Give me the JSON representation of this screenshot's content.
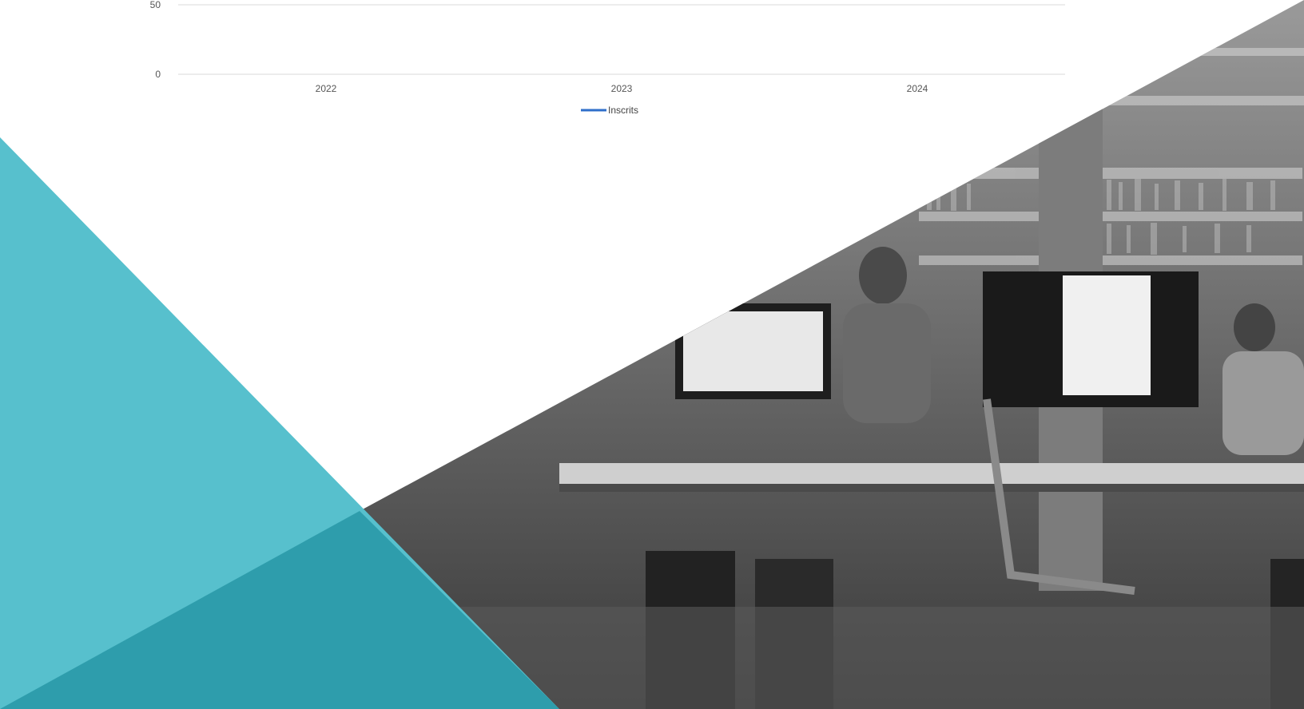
{
  "chart_data": {
    "type": "line",
    "categories": [
      "2022",
      "2023",
      "2024"
    ],
    "y_ticks": [
      0,
      50
    ],
    "series": [
      {
        "name": "Inscrits",
        "values": [],
        "color": "#2f6fca"
      }
    ],
    "title": "",
    "xlabel": "",
    "ylabel": "",
    "ylim": [
      0,
      50
    ],
    "grid": true,
    "legend": "bottom"
  },
  "colors": {
    "teal_accent": "#57c0cd",
    "teal_dark": "#2a99a8",
    "photo_tone": "#5c5c5c"
  },
  "background_image": "grayscale photo of students working at computers in a library"
}
